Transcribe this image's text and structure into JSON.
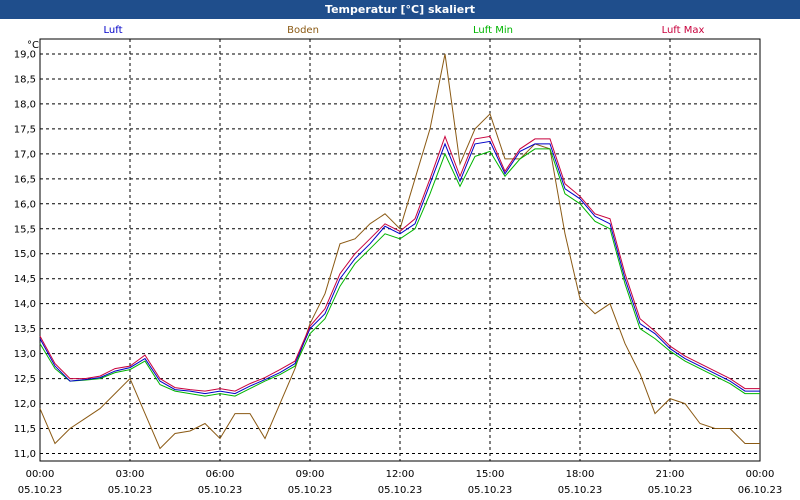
{
  "window": {
    "title": "Temperatur [°C] skaliert"
  },
  "chart_data": {
    "type": "line",
    "title": "Temperatur [°C] skaliert",
    "ylabel": "°C",
    "ylim": [
      10.85,
      19.3
    ],
    "yticks": [
      "11,0",
      "11,5",
      "12,0",
      "12,5",
      "13,0",
      "13,5",
      "14,0",
      "14,5",
      "15,0",
      "15,5",
      "16,0",
      "16,5",
      "17,0",
      "17,5",
      "18,0",
      "18,5",
      "19,0"
    ],
    "xlim": [
      0,
      24
    ],
    "xticks": [
      {
        "time": "00:00",
        "date": "05.10.23"
      },
      {
        "time": "03:00",
        "date": "05.10.23"
      },
      {
        "time": "06:00",
        "date": "05.10.23"
      },
      {
        "time": "09:00",
        "date": "05.10.23"
      },
      {
        "time": "12:00",
        "date": "05.10.23"
      },
      {
        "time": "15:00",
        "date": "05.10.23"
      },
      {
        "time": "18:00",
        "date": "05.10.23"
      },
      {
        "time": "21:00",
        "date": "05.10.23"
      },
      {
        "time": "00:00",
        "date": "06.10.23"
      }
    ],
    "grid": true,
    "legend_position": "top",
    "x_hours": [
      0,
      0.5,
      1,
      1.5,
      2,
      2.5,
      3,
      3.5,
      4,
      4.5,
      5,
      5.5,
      6,
      6.5,
      7,
      7.5,
      8,
      8.5,
      9,
      9.5,
      10,
      10.5,
      11,
      11.5,
      12,
      12.5,
      13,
      13.5,
      14,
      14.5,
      15,
      15.5,
      16,
      16.5,
      17,
      17.5,
      18,
      18.5,
      19,
      19.5,
      20,
      20.5,
      21,
      21.5,
      22,
      22.5,
      23,
      23.5,
      24
    ],
    "series": [
      {
        "name": "Luft",
        "color": "#0000c8",
        "values": [
          13.3,
          12.75,
          12.45,
          12.48,
          12.52,
          12.65,
          12.72,
          12.9,
          12.45,
          12.28,
          12.25,
          12.2,
          12.25,
          12.2,
          12.35,
          12.48,
          12.62,
          12.8,
          13.5,
          13.8,
          14.5,
          14.9,
          15.2,
          15.55,
          15.4,
          15.6,
          16.4,
          17.2,
          16.45,
          17.2,
          17.25,
          16.6,
          17.05,
          17.2,
          17.2,
          16.3,
          16.1,
          15.75,
          15.6,
          14.5,
          13.6,
          13.4,
          13.1,
          12.9,
          12.75,
          12.6,
          12.45,
          12.25,
          12.25
        ]
      },
      {
        "name": "Boden",
        "color": "#8b5a14",
        "values": [
          11.9,
          11.2,
          11.5,
          11.7,
          11.9,
          12.2,
          12.5,
          11.8,
          11.1,
          11.4,
          11.45,
          11.6,
          11.3,
          11.8,
          11.8,
          11.3,
          12.0,
          12.7,
          13.6,
          14.2,
          15.2,
          15.3,
          15.6,
          15.8,
          15.5,
          16.5,
          17.5,
          19.0,
          16.8,
          17.5,
          17.8,
          16.9,
          16.9,
          17.2,
          17.1,
          15.4,
          14.1,
          13.8,
          14.0,
          13.2,
          12.6,
          11.8,
          12.1,
          12.0,
          11.6,
          11.5,
          11.5,
          11.2,
          11.2
        ]
      },
      {
        "name": "Luft Min",
        "color": "#00b400",
        "values": [
          13.2,
          12.7,
          12.45,
          12.47,
          12.5,
          12.62,
          12.68,
          12.85,
          12.38,
          12.25,
          12.2,
          12.15,
          12.2,
          12.15,
          12.3,
          12.45,
          12.58,
          12.75,
          13.4,
          13.7,
          14.35,
          14.8,
          15.1,
          15.4,
          15.3,
          15.5,
          16.2,
          17.0,
          16.35,
          16.95,
          17.05,
          16.55,
          16.9,
          17.1,
          17.1,
          16.2,
          16.0,
          15.65,
          15.5,
          14.4,
          13.5,
          13.3,
          13.05,
          12.85,
          12.7,
          12.55,
          12.4,
          12.2,
          12.2
        ]
      },
      {
        "name": "Luft Max",
        "color": "#c8003c",
        "values": [
          13.35,
          12.8,
          12.5,
          12.5,
          12.55,
          12.7,
          12.75,
          12.97,
          12.5,
          12.32,
          12.28,
          12.25,
          12.3,
          12.25,
          12.4,
          12.52,
          12.68,
          12.85,
          13.55,
          13.9,
          14.6,
          15.0,
          15.3,
          15.6,
          15.45,
          15.7,
          16.5,
          17.35,
          16.55,
          17.3,
          17.35,
          16.65,
          17.1,
          17.3,
          17.3,
          16.4,
          16.15,
          15.8,
          15.7,
          14.6,
          13.7,
          13.45,
          13.15,
          12.95,
          12.8,
          12.65,
          12.5,
          12.3,
          12.3
        ]
      }
    ]
  }
}
